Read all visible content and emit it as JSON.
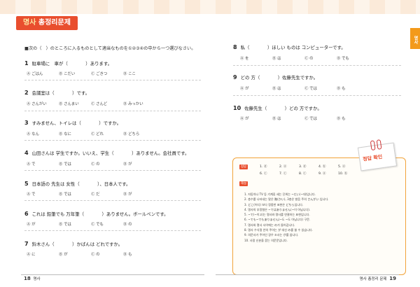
{
  "header": {
    "title_a": "명사",
    "title_b": "총정리문제",
    "side_tab": "명사"
  },
  "instruction": "■次の（　）のところに入るものとして適当なものを①②③④の中から一つ選びなさい。",
  "left_questions": [
    {
      "num": "1",
      "text": "駐車場に　車が（　　　　）あります。",
      "options": [
        "Ⓐ ごはん",
        "Ⓑ こだい",
        "Ⓒ ごきつ",
        "Ⓓ ここ"
      ]
    },
    {
      "num": "2",
      "text": "会議室は（　　　　）です。",
      "options": [
        "Ⓐ さんがい",
        "Ⓑ さんまい",
        "Ⓒ さんど",
        "Ⓓ みっかい"
      ]
    },
    {
      "num": "3",
      "text": "すみません、トイレは（　　　　）ですか。",
      "options": [
        "Ⓐ なん",
        "Ⓑ なに",
        "Ⓒ どれ",
        "Ⓓ どちら"
      ]
    },
    {
      "num": "4",
      "text": "山田さんは 学生ですか。いいえ、学生（　　　　）ありません。会社員です。",
      "options": [
        "Ⓐ で",
        "Ⓑ では",
        "Ⓒ の",
        "Ⓓ が"
      ]
    },
    {
      "num": "5",
      "text": "日本語の 先生は 女性（　　　　）、日本人です。",
      "options": [
        "Ⓐ で",
        "Ⓑ では",
        "Ⓒ だ",
        "Ⓓ が"
      ]
    },
    {
      "num": "6",
      "text": "これは 鉛筆でも 万年筆（　　　　）ありません。ボールペンです。",
      "options": [
        "Ⓐ が",
        "Ⓑ では",
        "Ⓒ でも",
        "Ⓓ の"
      ]
    },
    {
      "num": "7",
      "text": "鈴木さん（　　　　）かばんは どれですか。",
      "options": [
        "Ⓐ に",
        "Ⓑ が",
        "Ⓒ の",
        "Ⓓ も"
      ]
    }
  ],
  "right_questions": [
    {
      "num": "8",
      "text": "私（　　　　）ほしい ものは コンピューターです。",
      "options": [
        "Ⓐ を",
        "Ⓑ は",
        "Ⓒ の",
        "Ⓓ でも"
      ]
    },
    {
      "num": "9",
      "text": "どの 方（　　　　）佐藤先生ですか。",
      "options": [
        "Ⓐ が",
        "Ⓑ は",
        "Ⓒ では",
        "Ⓓ も"
      ]
    },
    {
      "num": "10",
      "text": "佐藤先生（　　　　）どの 方ですか。",
      "options": [
        "Ⓐ が",
        "Ⓑ は",
        "Ⓒ では",
        "Ⓓ も"
      ]
    }
  ],
  "memo": "정답 확인",
  "answers": {
    "badge_1": "정답",
    "row1": [
      "1. ⓓ",
      "2. ⓐ",
      "3. ⓓ",
      "4. ⓑ",
      "5. ⓐ"
    ],
    "row2": [
      "6. ⓒ",
      "7. ⓒ",
      "8. ⓒ",
      "9. ⓐ",
      "10. ⓑ"
    ],
    "badge_2": "해설",
    "explain": [
      "1. 자동차나 TV 등 기계류 세는 단위는 ~だい(~대)입니다.",
      "2. 층수를 나타내는 말은 階(かい), 3층은 발음 주의 さんがい 입니다.",
      "3. どこ(어디) 보다 정중한 표현은 どちら입니다.",
      "4. 명사의 부정형은 ~ではありません(~이 아닙니다).",
      "5. ~で(~이고)는 명사와 명사를 연결하는 표현입니다.",
      "6. ~でも~でもありません(~도 ~도 아닙니다) 구문.",
      "7. 명사와 명사 사이에는 の가 들어갑니다.",
      "8. 명사 수식절 안의 주어는 が 대신 の를 쓸 수 있습니다.",
      "9. 의문사가 주어인 경우 조사는 が를 씁니다.",
      "10. 사람 신분을 묻는 의문문입니다."
    ]
  },
  "footer": {
    "left_num": "18",
    "left_label": "명사",
    "right_label": "명사 총정리 문제",
    "right_num": "19"
  }
}
